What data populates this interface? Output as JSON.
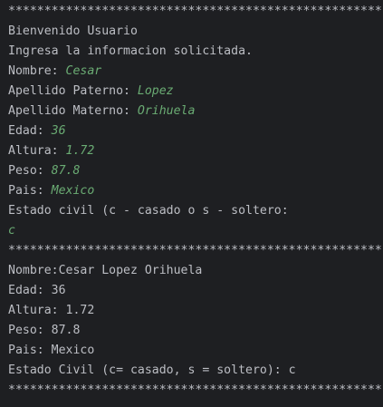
{
  "console": {
    "lines": [
      {
        "text": "****************************************************",
        "input": ""
      },
      {
        "text": "Bienvenido Usuario",
        "input": ""
      },
      {
        "text": "Ingresa la informacion solicitada.",
        "input": ""
      },
      {
        "text": "Nombre: ",
        "input": "Cesar"
      },
      {
        "text": "Apellido Paterno: ",
        "input": "Lopez"
      },
      {
        "text": "Apellido Materno: ",
        "input": "Orihuela"
      },
      {
        "text": "Edad: ",
        "input": "36"
      },
      {
        "text": "Altura: ",
        "input": "1.72"
      },
      {
        "text": "Peso: ",
        "input": "87.8"
      },
      {
        "text": "Pais: ",
        "input": "Mexico"
      },
      {
        "text": "Estado civil (c - casado o s - soltero:",
        "input": ""
      },
      {
        "text": "",
        "input": "c"
      },
      {
        "text": "****************************************************",
        "input": ""
      },
      {
        "text": "Nombre:Cesar Lopez Orihuela",
        "input": ""
      },
      {
        "text": "Edad: 36",
        "input": ""
      },
      {
        "text": "Altura: 1.72",
        "input": ""
      },
      {
        "text": "Peso: 87.8",
        "input": ""
      },
      {
        "text": "Pais: Mexico",
        "input": ""
      },
      {
        "text": "Estado Civil (c= casado, s = soltero): c",
        "input": ""
      },
      {
        "text": "****************************************************",
        "input": ""
      }
    ]
  },
  "colors": {
    "background": "#1e1f22",
    "output_text": "#bcbec4",
    "user_input": "#6aab73"
  }
}
